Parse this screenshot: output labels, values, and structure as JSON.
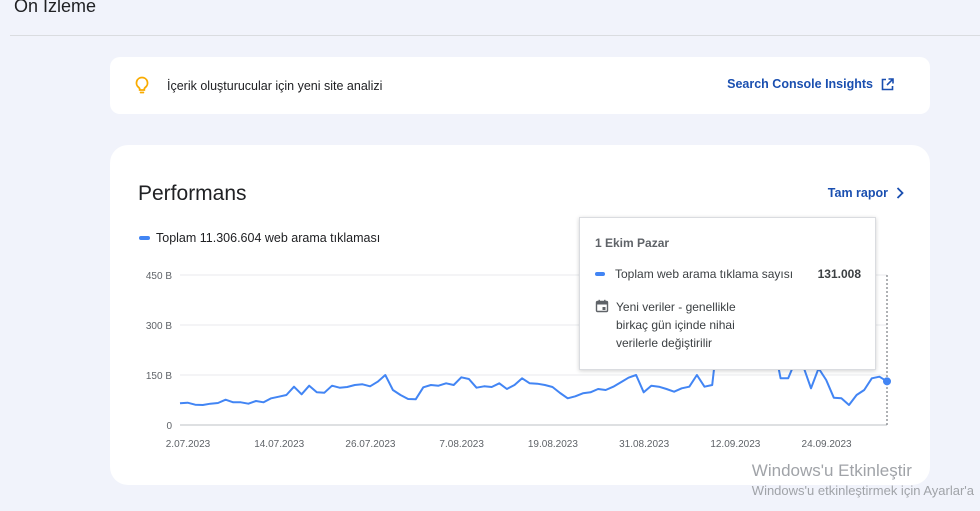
{
  "header": {
    "title": "Ön İzleme"
  },
  "insights": {
    "text": "İçerik oluşturucular için yeni site analizi",
    "link_label": "Search Console Insights"
  },
  "performance": {
    "title": "Performans",
    "full_report_label": "Tam rapor",
    "legend_label": "Toplam 11.306.604 web arama tıklaması"
  },
  "tooltip": {
    "date": "1 Ekim Pazar",
    "metric_label": "Toplam web arama tıklama sayısı",
    "metric_value": "131.008",
    "note_line1": "Yeni veriler - genellikle",
    "note_line2": "birkaç gün içinde nihai",
    "note_line3": "verilerle değiştirilir"
  },
  "watermark": {
    "title": "Windows'u Etkinleştir",
    "subtitle": "Windows'u etkinleştirmek için Ayarlar'a"
  },
  "colors": {
    "series": "#4285f4",
    "link": "#1a4fb0",
    "bulb": "#f9ab00"
  },
  "chart_data": {
    "type": "line",
    "x_ticks": [
      "2.07.2023",
      "14.07.2023",
      "26.07.2023",
      "7.08.2023",
      "19.08.2023",
      "31.08.2023",
      "12.09.2023",
      "24.09.2023"
    ],
    "y_ticks": [
      "0",
      "150 B",
      "300 B",
      "450 B"
    ],
    "ylim": [
      0,
      450
    ],
    "series": [
      {
        "name": "Toplam 11.306.604 web arama tıklaması",
        "start_date": "2023-07-02",
        "values": [
          65,
          67,
          61,
          60,
          64,
          66,
          76,
          68,
          68,
          64,
          72,
          68,
          80,
          85,
          90,
          115,
          92,
          118,
          98,
          97,
          118,
          112,
          114,
          120,
          122,
          116,
          130,
          150,
          105,
          90,
          78,
          77,
          113,
          120,
          118,
          125,
          120,
          143,
          138,
          112,
          116,
          114,
          125,
          108,
          120,
          140,
          125,
          124,
          120,
          114,
          96,
          80,
          86,
          95,
          98,
          108,
          105,
          115,
          128,
          142,
          150,
          98,
          118,
          115,
          108,
          100,
          110,
          115,
          150,
          115,
          120,
          320,
          410,
          380,
          340,
          260,
          230,
          245,
          255,
          140,
          140,
          195,
          175,
          110,
          170,
          135,
          82,
          80,
          60,
          90,
          105,
          140,
          145,
          131
        ]
      }
    ],
    "highlight": {
      "date": "1 Ekim Pazar",
      "value": 131
    }
  }
}
